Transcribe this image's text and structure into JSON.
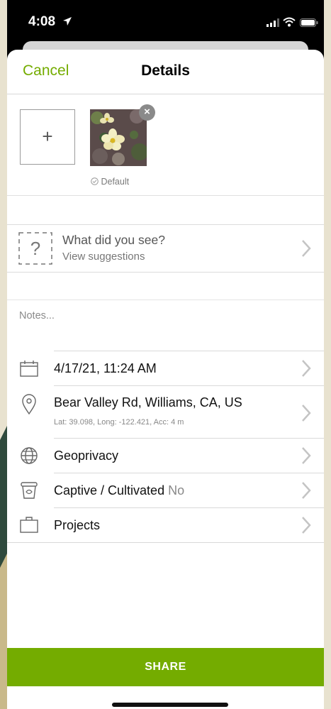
{
  "status_bar": {
    "time": "4:08"
  },
  "nav": {
    "cancel_label": "Cancel",
    "title": "Details"
  },
  "photos": {
    "add_label": "+",
    "remove_label": "×",
    "default_label": "Default"
  },
  "species": {
    "prompt": "What did you see?",
    "suggestions_label": "View suggestions"
  },
  "notes": {
    "placeholder": "Notes..."
  },
  "details": {
    "date": "4/17/21, 11:24 AM",
    "location": "Bear Valley Rd, Williams, CA, US",
    "location_meta": "Lat: 39.098, Long: -122.421, Acc: 4 m",
    "geoprivacy_label": "Geoprivacy",
    "captive_label": "Captive / Cultivated",
    "captive_value": "No",
    "projects_label": "Projects"
  },
  "share_label": "SHARE",
  "colors": {
    "accent": "#74ac00",
    "background": "#e8e2cf"
  }
}
